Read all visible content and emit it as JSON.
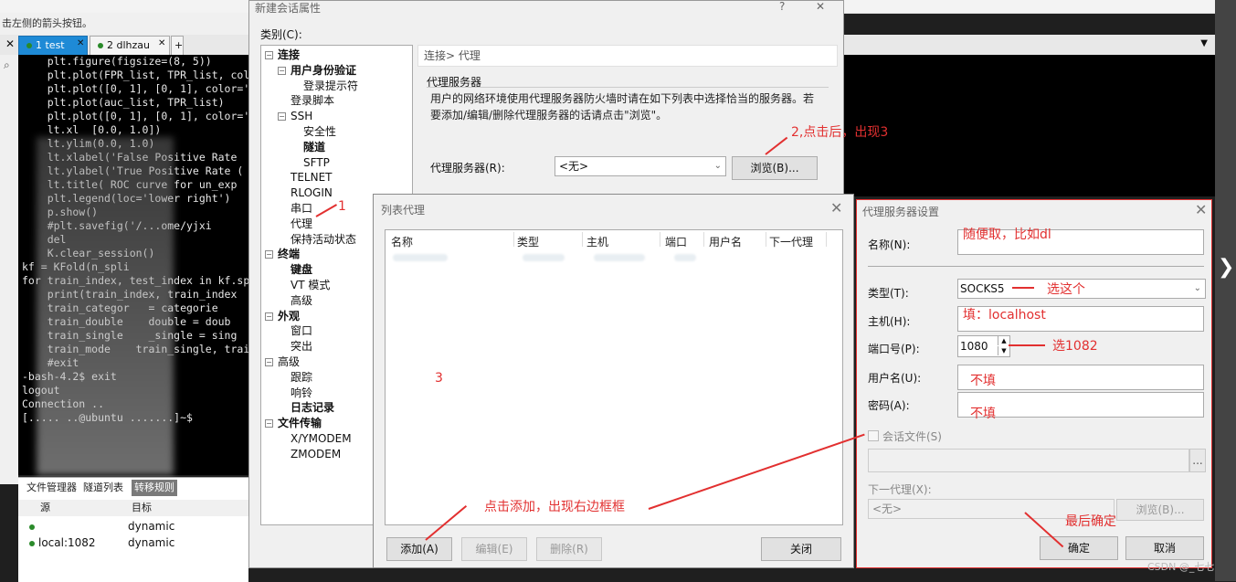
{
  "background": {
    "hint_text": "击左侧的箭头按钮。",
    "tabs": [
      {
        "label": "1 test",
        "active": true
      },
      {
        "label": "2 dlhzau",
        "active": false
      }
    ],
    "add_tab": "+",
    "terminal_lines": [
      "    plt.figure(figsize=(8, 5))",
      "    plt.plot(FPR_list, TPR_list, col",
      "    plt.plot([0, 1], [0, 1], color='",
      "    plt.plot(auc_list, TPR_list)",
      "    plt.plot([0, 1], [0, 1], color='",
      "    lt.xl  [0.0, 1.0])",
      "    lt.ylim(0.0, 1.0)",
      "    lt.xlabel('False Positive Rate",
      "    lt.ylabel('True Positive Rate (",
      "    lt.title( ROC curve for un_exp",
      "    plt.legend(loc='lower right')",
      "    p.show()",
      "    #plt.savefig('/...ome/yjxi",
      "    del",
      "    K.clear_session()",
      "",
      "",
      "kf = KFold(n_spli",
      "for train_index, test_index in kf.sp",
      "    print(train_index, train_index",
      "",
      "    train_categor   = categorie",
      "    train_double    double = doub",
      "    train_single    _single = sing",
      "",
      "    train_mode    train_single, train",
      "    #exit",
      "-bash-4.2$ exit",
      "logout",
      "Connection ..",
      "[..... ..@ubuntu .......]~$ "
    ],
    "bottom_tabs": [
      "文件管理器",
      "隧道列表",
      "转移规则"
    ],
    "bottom_columns": [
      "源",
      "目标"
    ],
    "bottom_rows": [
      {
        "source": "",
        "target": "dynamic"
      },
      {
        "source": "local:1082",
        "target": "dynamic"
      }
    ],
    "watermark": "CSDN @_七七"
  },
  "props_dialog": {
    "title": "新建会话属性",
    "help": "?",
    "close": "✕",
    "category_label": "类别(C):",
    "tree": [
      {
        "label": "连接",
        "bold": true,
        "level": 0,
        "expand": "−"
      },
      {
        "label": "用户身份验证",
        "bold": true,
        "level": 1,
        "expand": "−"
      },
      {
        "label": "登录提示符",
        "bold": false,
        "level": 2
      },
      {
        "label": "登录脚本",
        "bold": false,
        "level": 1
      },
      {
        "label": "SSH",
        "bold": false,
        "level": 1,
        "expand": "−"
      },
      {
        "label": "安全性",
        "bold": false,
        "level": 2
      },
      {
        "label": "隧道",
        "bold": true,
        "level": 2
      },
      {
        "label": "SFTP",
        "bold": false,
        "level": 2
      },
      {
        "label": "TELNET",
        "bold": false,
        "level": 1
      },
      {
        "label": "RLOGIN",
        "bold": false,
        "level": 1
      },
      {
        "label": "串口",
        "bold": false,
        "level": 1
      },
      {
        "label": "代理",
        "bold": false,
        "level": 1
      },
      {
        "label": "保持活动状态",
        "bold": false,
        "level": 1
      },
      {
        "label": "终端",
        "bold": true,
        "level": 0,
        "expand": "−"
      },
      {
        "label": "键盘",
        "bold": true,
        "level": 1
      },
      {
        "label": "VT 模式",
        "bold": false,
        "level": 1
      },
      {
        "label": "高级",
        "bold": false,
        "level": 1
      },
      {
        "label": "外观",
        "bold": true,
        "level": 0,
        "expand": "−"
      },
      {
        "label": "窗口",
        "bold": false,
        "level": 1
      },
      {
        "label": "突出",
        "bold": false,
        "level": 1
      },
      {
        "label": "高级",
        "bold": false,
        "level": 0,
        "expand": "−"
      },
      {
        "label": "跟踪",
        "bold": false,
        "level": 1
      },
      {
        "label": "响铃",
        "bold": false,
        "level": 1
      },
      {
        "label": "日志记录",
        "bold": true,
        "level": 1
      },
      {
        "label": "文件传输",
        "bold": true,
        "level": 0,
        "expand": "−"
      },
      {
        "label": "X/YMODEM",
        "bold": false,
        "level": 1
      },
      {
        "label": "ZMODEM",
        "bold": false,
        "level": 1
      }
    ],
    "breadcrumb": "连接> 代理",
    "group_title": "代理服务器",
    "description": "用户的网络环境使用代理服务器防火墙时请在如下列表中选择恰当的服务器。若要添加/编辑/删除代理服务器的话请点击\"浏览\"。",
    "proxy_label": "代理服务器(R):",
    "proxy_value": "<无>",
    "browse_button": "浏览(B)..."
  },
  "list_dialog": {
    "title": "列表代理",
    "close": "✕",
    "columns": [
      "名称",
      "类型",
      "主机",
      "端口",
      "用户名",
      "下一代理"
    ],
    "add_button": "添加(A)",
    "edit_button": "编辑(E)",
    "delete_button": "删除(R)",
    "close_button": "关闭"
  },
  "settings_dialog": {
    "title": "代理服务器设置",
    "close": "✕",
    "name_label": "名称(N):",
    "name_value": "",
    "type_label": "类型(T):",
    "type_value": "SOCKS5",
    "host_label": "主机(H):",
    "host_value": "",
    "port_label": "端口号(P):",
    "port_value": "1080",
    "username_label": "用户名(U):",
    "password_label": "密码(A):",
    "session_file_label": "会话文件(S)",
    "session_browse": "...",
    "next_proxy_label": "下一代理(X):",
    "next_proxy_value": "<无>",
    "next_proxy_browse": "浏览(B)...",
    "ok_button": "确定",
    "cancel_button": "取消"
  },
  "annotations": {
    "a1": "1",
    "a2": "2,点击后，出现3",
    "a3": "3",
    "a4": "点击添加，出现右边框框",
    "name_hint": "随便取，比如dl",
    "type_hint": "选这个",
    "host_hint": "填：localhost",
    "port_hint": "选1082",
    "user_hint": "不填",
    "pass_hint": "不填",
    "ok_hint": "最后确定"
  },
  "colors": {
    "annotation": "#e23030",
    "active_tab": "#1e8ad6"
  }
}
